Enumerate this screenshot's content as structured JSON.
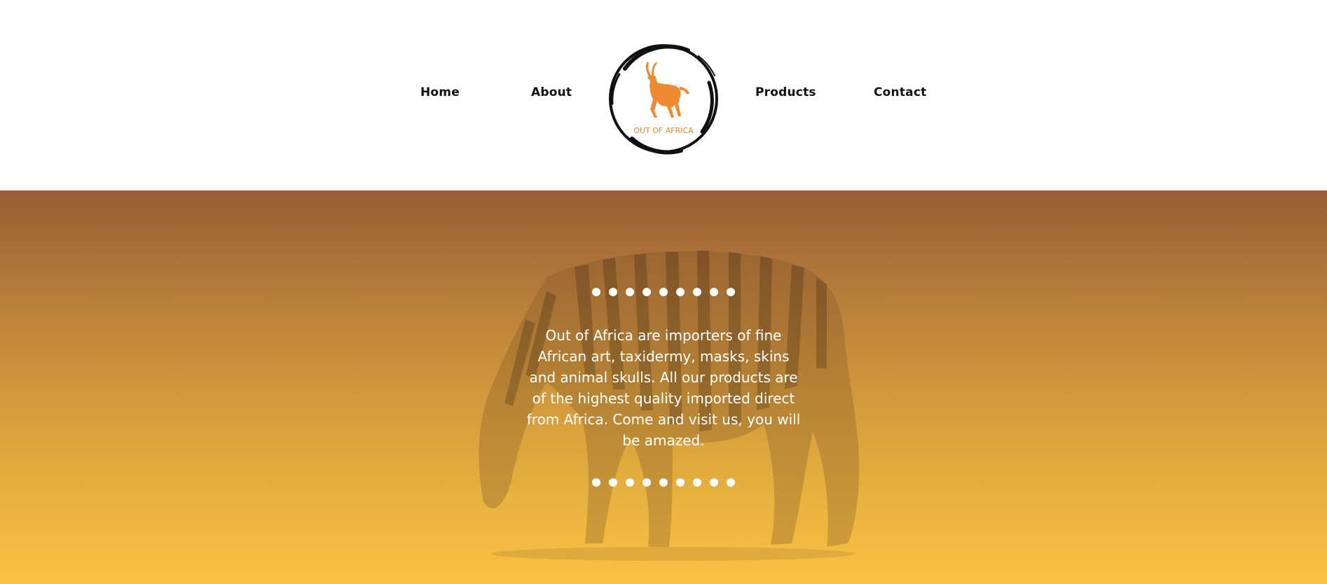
{
  "nav": {
    "items": [
      {
        "label": "Home"
      },
      {
        "label": "About"
      },
      {
        "label": "Products"
      },
      {
        "label": "Contact"
      }
    ]
  },
  "logo": {
    "text": "OUT OF AFRICA",
    "icon": "gazelle-icon",
    "accent_color": "#f08a30"
  },
  "hero": {
    "text": "Out of Africa are importers of fine African art, taxidermy, masks, skins and animal skulls. All our products are of the highest quality imported direct from Africa. Come and visit us, you will be amazed.",
    "background_colors": [
      "#975d35",
      "#fac243"
    ],
    "image": "zebra"
  }
}
